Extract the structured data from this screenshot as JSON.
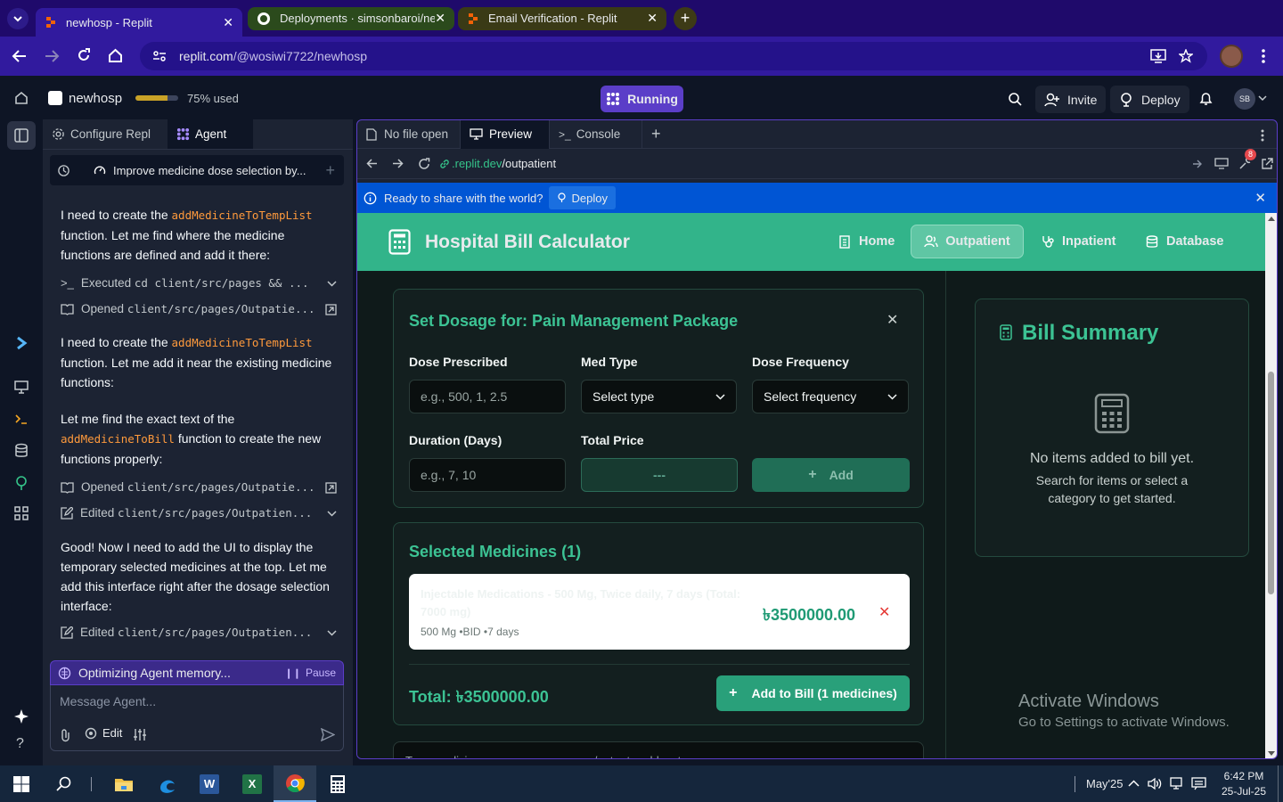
{
  "browser": {
    "tabs": [
      {
        "title": "newhosp - Replit",
        "active": true
      },
      {
        "title": "Deployments · simsonbaroi/ne",
        "active": false
      },
      {
        "title": "Email Verification - Replit",
        "active": false
      }
    ],
    "url_host": "replit.com",
    "url_path": "/@wosiwi7722/newhosp"
  },
  "replit": {
    "project_name": "newhosp",
    "usage_label": "75% used",
    "usage_fraction": 0.75,
    "run_status": "Running",
    "invite_label": "Invite",
    "deploy_label": "Deploy",
    "avatar_initials": "SB"
  },
  "agent_pane": {
    "tab_configure": "Configure Repl",
    "tab_agent": "Agent",
    "thread_title": "Improve medicine dose selection by...",
    "messages": [
      {
        "pre": "I need to create the ",
        "code": "addMedicineToTempList",
        "post": " function. Let me find where the medicine functions are defined and add it there:"
      },
      {
        "pre": "I need to create the ",
        "code": "addMedicineToTempList",
        "post": " function. Let me add it near the existing medicine functions:"
      },
      {
        "pre": "Let me find the exact text of the ",
        "code": "addMedicineToBill",
        "post": " function to create the new functions properly:"
      },
      {
        "pre": "Good! Now I need to add the UI to display the temporary selected medicines at the top. Let me add this interface right after the dosage selection interface:",
        "code": "",
        "post": ""
      }
    ],
    "actions": [
      {
        "verb": "Executed",
        "target": "cd client/src/pages && ..."
      },
      {
        "verb": "Opened",
        "target": "client/src/pages/Outpatie..."
      },
      {
        "verb": "Opened",
        "target": "client/src/pages/Outpatie..."
      },
      {
        "verb": "Edited",
        "target": "client/src/pages/Outpatien..."
      },
      {
        "verb": "Edited",
        "target": "client/src/pages/Outpatien..."
      }
    ],
    "status_text": "Optimizing Agent memory...",
    "pause_label": "Pause",
    "input_placeholder": "Message Agent...",
    "edit_label": "Edit"
  },
  "workspace": {
    "tabs": [
      "No file open",
      "Preview",
      "Console"
    ],
    "preview_host": ".replit.dev",
    "preview_path": "/outpatient",
    "notif_count": "8",
    "banner_text": "Ready to share with the world?",
    "banner_button": "Deploy"
  },
  "site": {
    "title": "Hospital Bill Calculator",
    "nav": [
      "Home",
      "Outpatient",
      "Inpatient",
      "Database"
    ],
    "dosage": {
      "heading": "Set Dosage for: Pain Management Package",
      "dose_label": "Dose Prescribed",
      "dose_placeholder": "e.g., 500, 1, 2.5",
      "medtype_label": "Med Type",
      "medtype_value": "Select type",
      "freq_label": "Dose Frequency",
      "freq_value": "Select frequency",
      "duration_label": "Duration (Days)",
      "duration_placeholder": "e.g., 7, 10",
      "total_label": "Total Price",
      "total_value": "---",
      "add_label": "Add"
    },
    "selected": {
      "heading": "Selected Medicines (1)",
      "item_name": "Injectable Medications - 500 Mg, Twice daily, 7 days (Total: 7000 mg)",
      "item_meta": "500 Mg •BID •7 days",
      "item_price": "৳3500000.00",
      "total_text": "Total: ৳3500000.00",
      "add_to_bill": "Add to Bill (1 medicines)"
    },
    "search_placeholder": "Type medicine names, press comma/enter to add as tags",
    "bill": {
      "heading": "Bill Summary",
      "empty_title": "No items added to bill yet.",
      "empty_sub": "Search for items or select a category to get started."
    },
    "watermark_title": "Activate Windows",
    "watermark_sub": "Go to Settings to activate Windows."
  },
  "taskbar": {
    "weather": "May'25",
    "time": "6:42 PM",
    "date": "25-Jul-25"
  }
}
